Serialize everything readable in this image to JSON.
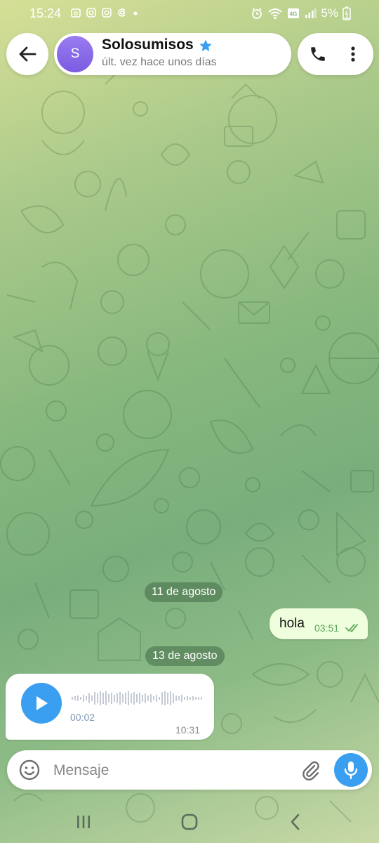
{
  "status_bar": {
    "time": "15:24",
    "battery": "5%",
    "left_icons": [
      "calendar-icon",
      "instagram-icon",
      "instagram-icon",
      "threads-icon",
      "dot-icon"
    ],
    "right_icons": [
      "alarm-icon",
      "wifi-icon",
      "volte-icon",
      "signal-icon",
      "battery-icon"
    ]
  },
  "header": {
    "avatar_letter": "S",
    "name": "Solosumisos",
    "last_seen": "últ. vez hace unos días"
  },
  "messages": [
    {
      "type": "date",
      "label": "11 de agosto"
    },
    {
      "type": "outgoing",
      "text": "hola",
      "time": "03:51",
      "status": "read"
    },
    {
      "type": "date",
      "label": "13 de agosto"
    },
    {
      "type": "incoming-voice",
      "duration": "00:02",
      "time": "10:31"
    }
  ],
  "input": {
    "placeholder": "Mensaje"
  },
  "colors": {
    "accent": "#3a9ff0",
    "outgoing_bubble": "#effedd",
    "avatar": "#8a6ae8",
    "read_ticks": "#5ca85a"
  }
}
